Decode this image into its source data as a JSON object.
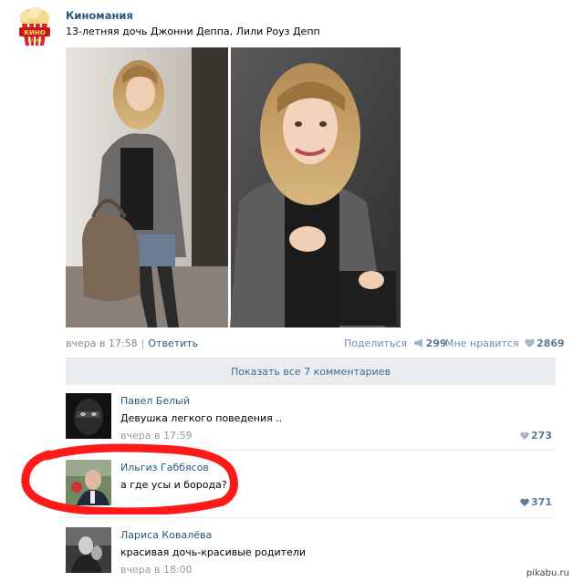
{
  "post": {
    "group_name": "Киномания",
    "logo_text": "КИНО",
    "logo_subtext": "МАНИЯ",
    "text": "13-летняя дочь Джонни Деппа, Лили Роуз Депп",
    "time": "вчера в 17:58",
    "reply_label": "Ответить",
    "share_label": "Поделиться",
    "share_count": "299",
    "like_label": "Мне нравится",
    "like_count": "2869"
  },
  "comments_bar": {
    "label": "Показать все 7 комментариев"
  },
  "comments": [
    {
      "author": "Павел Белый",
      "text": "Девушка легкого поведения ..",
      "time": "вчера в 17:59",
      "likes": "273"
    },
    {
      "author": "Ильгиз Габбясов",
      "text": "а где усы и борода?",
      "time": "",
      "likes": "371"
    },
    {
      "author": "Лариса Ковалёва",
      "text": "красивая дочь-красивые родители",
      "time": "вчера в 18:00",
      "likes": ""
    }
  ],
  "watermark": "pikabu.ru",
  "colors": {
    "link": "#2b587a",
    "bar": "#e9edf1",
    "highlight": "#ff0000"
  },
  "icons": [
    "megaphone-icon",
    "heart-icon"
  ]
}
